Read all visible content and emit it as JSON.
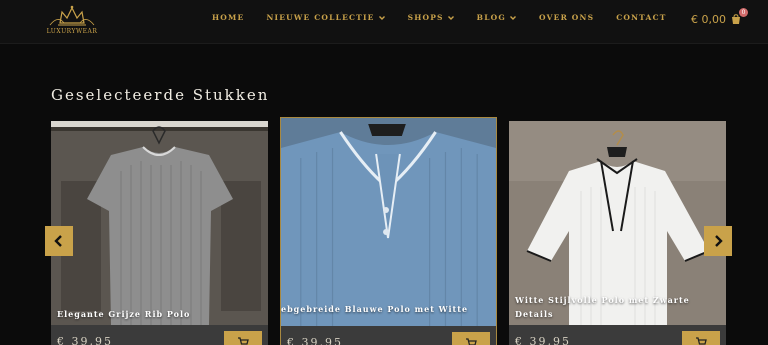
{
  "header": {
    "logo_text": "LUXURYWEAR",
    "nav": [
      {
        "label": "HOME",
        "dropdown": false
      },
      {
        "label": "NIEUWE COLLECTIE",
        "dropdown": true
      },
      {
        "label": "SHOPS",
        "dropdown": true
      },
      {
        "label": "BLOG",
        "dropdown": true
      },
      {
        "label": "OVER ONS",
        "dropdown": false
      },
      {
        "label": "CONTACT",
        "dropdown": false
      }
    ],
    "cart_total": "€ 0,00",
    "cart_count": "0"
  },
  "section": {
    "title": "Geselecteerde Stukken"
  },
  "products": [
    {
      "name": "Elegante Grijze Rib Polo",
      "price": "€ 39,95",
      "color": "#8a8a8a"
    },
    {
      "name": "ebgebreide Blauwe Polo met Witte",
      "price": "€ 39,95",
      "color": "#6f8fb0"
    },
    {
      "name": "Witte Stijlvolle Polo met Zwarte Details",
      "price": "€ 39,95",
      "color": "#ececec"
    }
  ],
  "colors": {
    "accent": "#c9a24a",
    "background": "#0b0b0b",
    "header": "#111111"
  },
  "icons": {
    "prev": "chevron-left-icon",
    "next": "chevron-right-icon",
    "cart": "cart-icon"
  }
}
